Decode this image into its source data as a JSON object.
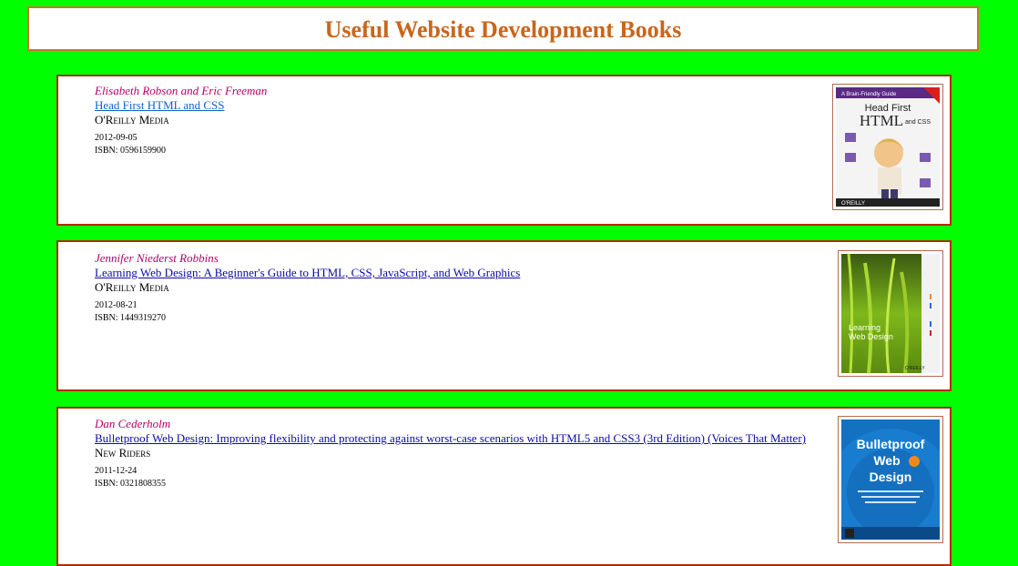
{
  "page": {
    "title": "Useful Website Development Books"
  },
  "books": [
    {
      "author": "Elisabeth Robson and Eric Freeman",
      "title": "Head First HTML and CSS",
      "publisher": "O'Reilly Media",
      "date": "2012-09-05",
      "isbn": "ISBN: 0596159900",
      "cover": {
        "icon": "book-cover-head-first",
        "top_label": "A Brain-Friendly Guide",
        "line1": "Head First",
        "line2": "HTML",
        "line3": "and CSS",
        "footer": "O'REILLY"
      }
    },
    {
      "author": "Jennifer Niederst Robbins",
      "title": "Learning Web Design: A Beginner's Guide to HTML, CSS, JavaScript, and Web Graphics",
      "publisher": "O'Reilly Media",
      "date": "2012-08-21",
      "isbn": "ISBN: 1449319270",
      "cover": {
        "icon": "book-cover-learning-web-design",
        "line1": "Learning",
        "line2": "Web Design",
        "footer": "O'REILLY"
      }
    },
    {
      "author": "Dan Cederholm",
      "title": "Bulletproof Web Design: Improving flexibility and protecting against worst-case scenarios with HTML5 and CSS3 (3rd Edition) (Voices That Matter)",
      "publisher": "New Riders",
      "date": "2011-12-24",
      "isbn": "ISBN: 0321808355",
      "cover": {
        "icon": "book-cover-bulletproof-web-design",
        "line1": "Bulletproof",
        "line2": "Web",
        "line3": "Design"
      }
    }
  ],
  "colors": {
    "background": "#00ff00",
    "heading": "#c8661e",
    "author": "#b4006a",
    "link": "#0b0ba0",
    "card_border": "#b22c00"
  }
}
